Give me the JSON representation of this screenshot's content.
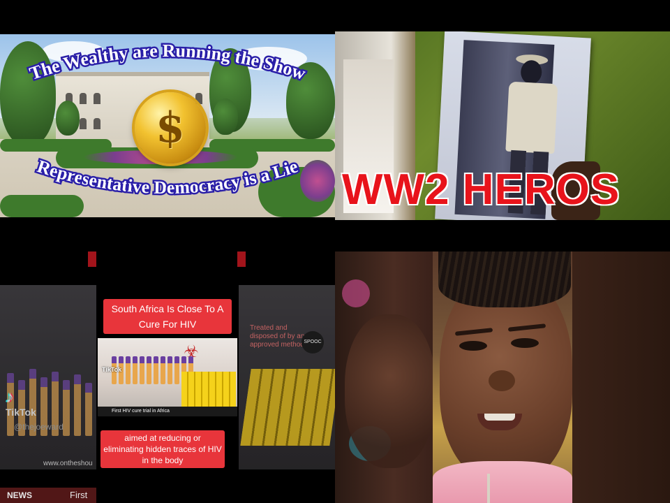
{
  "tiles": {
    "wealthy": {
      "top_text": "The Wealthy are Running the Show",
      "bottom_text": "Representative Democracy is a Lie",
      "coin_symbol": "$"
    },
    "ww2": {
      "headline": "WW2 HEROS"
    },
    "hiv": {
      "caption_top": "South Africa Is Close To A Cure For HIV",
      "caption_bottom": "aimed at reducing or eliminating hidden traces of HIV in the body",
      "tiktok_label": "TikTok",
      "tiktok_user": "@thejoeward",
      "video_tiktok_label": "TikTok",
      "video_ticker": "First HIV cure trial in Africa",
      "news_brand": "NEWS",
      "news_first": "First",
      "url_text": "www.ontheshou",
      "right_label": "Treated and\ndisposed of by an\napproved method",
      "right_logo": "SPOOC"
    },
    "portrait": {}
  },
  "colors": {
    "caption_red": "#e8353b",
    "headline_red": "#e8131b",
    "curve_text_stroke": "#2a1fa8"
  }
}
